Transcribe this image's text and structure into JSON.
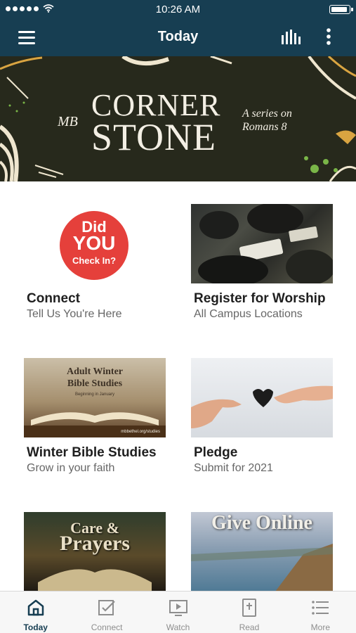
{
  "status_bar": {
    "time": "10:26 AM",
    "battery_level": 0.95
  },
  "header": {
    "title": "Today"
  },
  "banner": {
    "logo": "MB",
    "title_line1": "CORNER",
    "title_line2": "STONE",
    "series_line1": "A series on",
    "series_line2": "Romans 8"
  },
  "cards": [
    {
      "title": "Connect",
      "subtitle": "Tell Us You're Here",
      "image_text": {
        "did": "Did",
        "you": "YOU",
        "check_in": "Check In?"
      }
    },
    {
      "title": "Register for Worship",
      "subtitle": "All Campus Locations"
    },
    {
      "title": "Winter Bible Studies",
      "subtitle": "Grow in your faith",
      "image_text": {
        "line1": "Adult Winter",
        "line2": "Bible Studies",
        "line3": "Beginning in January",
        "url": "mbbethel.org/studies"
      }
    },
    {
      "title": "Pledge",
      "subtitle": "Submit for 2021"
    },
    {
      "image_text": {
        "line1": "Care &",
        "line2": "Prayers"
      }
    },
    {
      "image_text": {
        "line1": "Give Online"
      }
    }
  ],
  "tab_bar": {
    "tabs": [
      {
        "label": "Today",
        "icon": "home-icon",
        "active": true
      },
      {
        "label": "Connect",
        "icon": "checkbox-icon",
        "active": false
      },
      {
        "label": "Watch",
        "icon": "video-play-icon",
        "active": false
      },
      {
        "label": "Read",
        "icon": "bible-icon",
        "active": false
      },
      {
        "label": "More",
        "icon": "list-icon",
        "active": false
      }
    ]
  },
  "colors": {
    "header_bg": "#173e52",
    "active_tab": "#173e52",
    "inactive_tab": "#8e8e8e",
    "checkin_red": "#e5403b"
  }
}
